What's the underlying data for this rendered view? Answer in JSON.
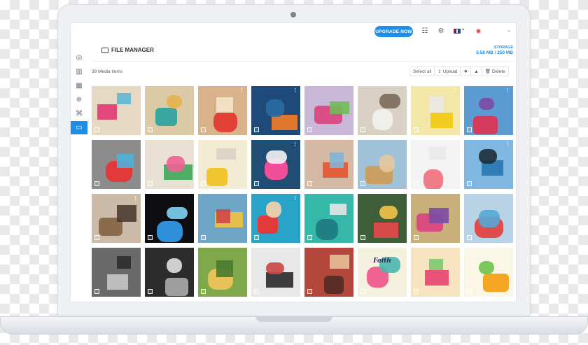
{
  "header": {
    "upgrade_label": "UPGRADE NOW",
    "title": "FILE MANAGER",
    "storage_label": "STORAGE",
    "storage_value": "5.58 MB / 250 MB"
  },
  "sidebar": {
    "items": [
      {
        "icon": "instagram-icon",
        "glyph": "◎"
      },
      {
        "icon": "bar-chart-icon",
        "glyph": "▥"
      },
      {
        "icon": "calendar-icon",
        "glyph": "▦"
      },
      {
        "icon": "plus-circle-icon",
        "glyph": "⊕"
      },
      {
        "icon": "command-icon",
        "glyph": "⌘"
      },
      {
        "icon": "folder-icon",
        "glyph": "▭",
        "active": true
      }
    ]
  },
  "toolbar": {
    "media_count": "39 Media items",
    "select_all": "Select all",
    "upload": "Upload",
    "delete": "Delete"
  },
  "colors": {
    "accent": "#1e8ee8"
  },
  "tiles": [
    {
      "bg": "#e6d9c4",
      "c1": "#e2487a",
      "c2": "#63b7d6",
      "dots": false
    },
    {
      "bg": "#dcc9a6",
      "c1": "#3aa6a0",
      "c2": "#e3b24d",
      "dots": false
    },
    {
      "bg": "#d8b28a",
      "c1": "#e24136",
      "c2": "#f4e4c8",
      "dots": true
    },
    {
      "bg": "#1d4a79",
      "c1": "#e0772e",
      "c2": "#2a6ea3",
      "dots": true
    },
    {
      "bg": "#c9b7d8",
      "c1": "#d94e86",
      "c2": "#6fbd59",
      "dots": false
    },
    {
      "bg": "#d9d1c4",
      "c1": "#f1efe9",
      "c2": "#7a6a5b",
      "dots": false
    },
    {
      "bg": "#f2e7a7",
      "c1": "#f2cd1f",
      "c2": "#e8e8e8",
      "dots": true
    },
    {
      "bg": "#5a9bd1",
      "c1": "#d53b5c",
      "c2": "#7a4aa0",
      "dots": true
    },
    {
      "bg": "#8c8c8c",
      "c1": "#e23a3a",
      "c2": "#4fb0d8",
      "dots": false
    },
    {
      "bg": "#e8e1d4",
      "c1": "#4fae66",
      "c2": "#f06292",
      "dots": false
    },
    {
      "bg": "#f3ecd4",
      "c1": "#f1c530",
      "c2": "#d9d3c5",
      "dots": false
    },
    {
      "bg": "#1f4d73",
      "c1": "#f04e98",
      "c2": "#f3f3f3",
      "dots": true
    },
    {
      "bg": "#d6b9a5",
      "c1": "#e35e3a",
      "c2": "#7fb6d6",
      "dots": false
    },
    {
      "bg": "#9fc2d8",
      "c1": "#c9a062",
      "c2": "#e6c89c",
      "dots": false
    },
    {
      "bg": "#f3f3f3",
      "c1": "#f07c87",
      "c2": "#e9e9e9",
      "dots": false
    },
    {
      "bg": "#7fb7e0",
      "c1": "#2f7db4",
      "c2": "#1f2d3a",
      "dots": true
    },
    {
      "bg": "#cbbba8",
      "c1": "#8b6b4d",
      "c2": "#4c3c2f",
      "dots": true
    },
    {
      "bg": "#0e0e12",
      "c1": "#2f8fd8",
      "c2": "#7fd3f4",
      "dots": false
    },
    {
      "bg": "#6fa6c8",
      "c1": "#e3c04b",
      "c2": "#cf4747",
      "dots": false
    },
    {
      "bg": "#2aa3c8",
      "c1": "#e23a3a",
      "c2": "#f6d2a8",
      "dots": true
    },
    {
      "bg": "#36b8a8",
      "c1": "#1f7f85",
      "c2": "#e6e6e6",
      "dots": false
    },
    {
      "bg": "#3e5e3a",
      "c1": "#d64a4a",
      "c2": "#f0c44a",
      "dots": false
    },
    {
      "bg": "#c9b07a",
      "c1": "#d94c80",
      "c2": "#7b4ba3",
      "dots": false
    },
    {
      "bg": "#b8d2e6",
      "c1": "#e04b4b",
      "c2": "#53a9d6",
      "dots": false
    },
    {
      "bg": "#6a6a6a",
      "c1": "#bdbdbd",
      "c2": "#2e2e2e",
      "dots": false
    },
    {
      "bg": "#2c2c2c",
      "c1": "#9e9e9e",
      "c2": "#e0e0e0",
      "dots": false
    },
    {
      "bg": "#7fa84a",
      "c1": "#e7c25a",
      "c2": "#4a7a2e",
      "dots": false
    },
    {
      "bg": "#e8e8e8",
      "c1": "#3c3c3c",
      "c2": "#c94545",
      "dots": false
    },
    {
      "bg": "#b4473b",
      "c1": "#5a2e25",
      "c2": "#e8c09a",
      "dots": false
    },
    {
      "bg": "#f5f1df",
      "c1": "#f06292",
      "c2": "#4db6ac",
      "dots": false,
      "text": "Faith"
    },
    {
      "bg": "#f7e3c0",
      "c1": "#e9537a",
      "c2": "#7bc96f",
      "dots": false
    },
    {
      "bg": "#fbf7e7",
      "c1": "#f5a623",
      "c2": "#6cc24a",
      "dots": false
    }
  ]
}
